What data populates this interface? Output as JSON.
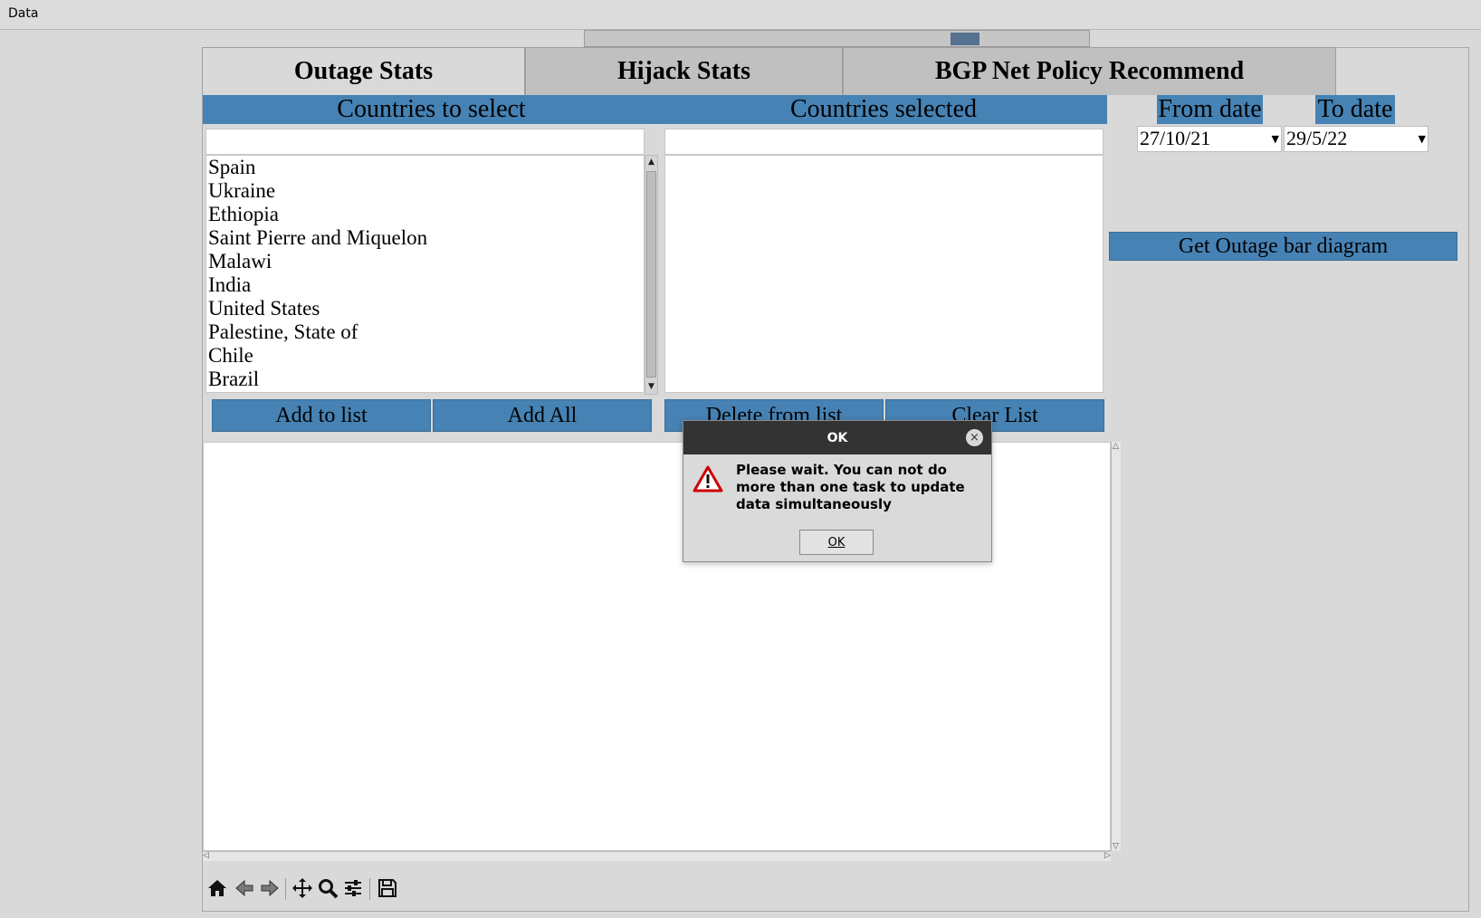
{
  "menubar": {
    "data_label": "Data"
  },
  "progress": {
    "value": 0.77
  },
  "tabs": [
    {
      "label": "Outage Stats",
      "active": true
    },
    {
      "label": "Hijack Stats",
      "active": false
    },
    {
      "label": "BGP Net Policy Recommend",
      "active": false
    }
  ],
  "countries_to_select": {
    "header": "Countries to select",
    "filter_value": "",
    "items": [
      "Spain",
      "Ukraine",
      "Ethiopia",
      "Saint Pierre and Miquelon",
      "Malawi",
      "India",
      "United States",
      "Palestine, State of",
      "Chile",
      "Brazil"
    ]
  },
  "countries_selected": {
    "header": "Countries selected",
    "filter_value": "",
    "items": []
  },
  "dates": {
    "from_label": "From date",
    "to_label": "To date",
    "from_value": "27/10/21",
    "to_value": "29/5/22"
  },
  "buttons": {
    "add_to_list": "Add to list",
    "add_all": "Add All",
    "delete_from_list": "Delete from list",
    "clear_list": "Clear List",
    "get_outage": "Get Outage bar diagram"
  },
  "toolbar": {
    "icons": [
      "home-icon",
      "back-arrow-icon",
      "forward-arrow-icon",
      "pan-icon",
      "zoom-icon",
      "configure-icon",
      "save-icon"
    ]
  },
  "dialog": {
    "title": "OK",
    "message": "Please wait. You can not do more than one task to update data simultaneously",
    "ok_label": "OK",
    "close_glyph": "×"
  },
  "colors": {
    "accent_blue": "#4682b4",
    "dialog_titlebar": "#333333",
    "warning_red": "#cc0000"
  }
}
